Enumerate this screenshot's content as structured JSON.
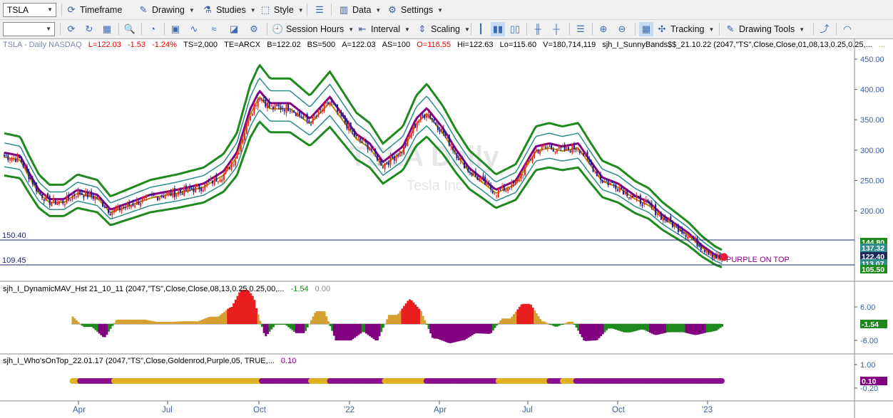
{
  "toolbar1": {
    "symbol": "TSLA",
    "timeframe": "Timeframe",
    "drawing": "Drawing",
    "studies": "Studies",
    "style": "Style",
    "data": "Data",
    "settings": "Settings"
  },
  "toolbar2": {
    "session_hours": "Session Hours",
    "interval": "Interval",
    "scaling": "Scaling",
    "tracking": "Tracking",
    "drawing_tools": "Drawing Tools"
  },
  "main": {
    "symbol_desc": "TSLA - Daily  NASDAQ",
    "low": "L=122.03",
    "change": "-1.53",
    "change_pct": "-1.24%",
    "ts": "TS=2,000",
    "te": "TE=ARCX",
    "bid": "B=122.02",
    "bs": "BS=500",
    "ask": "A=122.03",
    "as": "AS=100",
    "open": "O=116.55",
    "hi": "Hi=122.63",
    "lo": "Lo=115.60",
    "vol": "V=180,714,119",
    "study": "sjh_I_SunnyBands$$_21.10.22 (2047,\"TS\",Close,Close,01,08,13,0.25,0.25,...",
    "more": "...",
    "watermark1": "TSLA Daily",
    "watermark2": "Tesla Inc",
    "hline1": "150.40",
    "hline2": "109.45",
    "annotation": "PURPLE ON TOP",
    "yticks": [
      "450.00",
      "400.00",
      "350.00",
      "300.00",
      "250.00",
      "200.00"
    ],
    "ylabels": [
      {
        "v": "144.80",
        "c": "#1e8a1e"
      },
      {
        "v": "137.32",
        "c": "#2e8b8b"
      },
      {
        "v": "122.40",
        "c": "#1c2a5a"
      },
      {
        "v": "113.07",
        "c": "#2e8b8b"
      },
      {
        "v": "105.50",
        "c": "#1e8a1e"
      }
    ]
  },
  "pane2": {
    "title": "sjh_I_DynamicMAV_Hst 21_10_11 (2047,\"TS\",Close,Close,08,13,0.25,0.25,00,...",
    "val1": "-1.54",
    "val2": "0.00",
    "yticks": [
      "6.00",
      "-6.00"
    ],
    "last": "-1.54"
  },
  "pane3": {
    "title": "sjh_I_Who'sOnTop_22.01.17 (2047,\"TS\",Close,Goldenrod,Purple,05, TRUE,...",
    "val": "0.10",
    "yticks": [
      "1.00",
      "-0.20"
    ],
    "last": "0.10"
  },
  "xaxis": [
    "Apr",
    "Jul",
    "Oct",
    "'22",
    "Apr",
    "Jul",
    "Oct",
    "'23"
  ],
  "colors": {
    "up": "#e8281e",
    "down": "#1e1e8c",
    "band_outer": "#1e8a1e",
    "band_inner": "#2e8b8b",
    "purple": "#800080",
    "gold": "#b8860b"
  }
}
